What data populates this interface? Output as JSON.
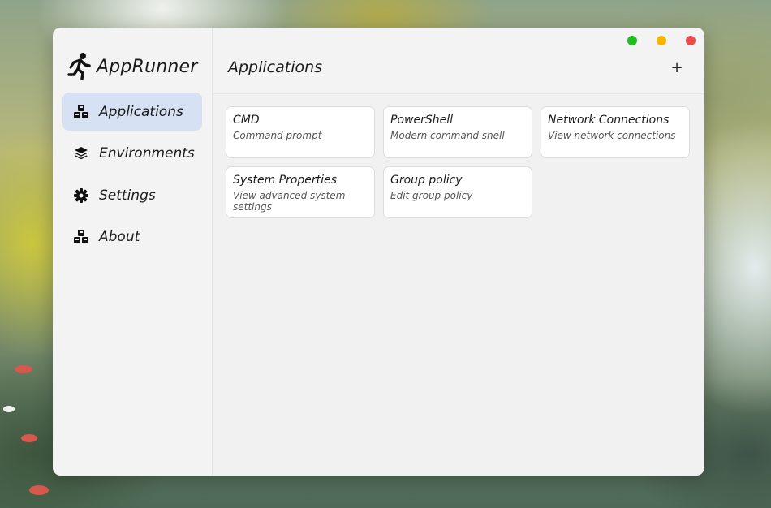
{
  "app": {
    "name": "AppRunner",
    "logo_icon": "running-person-icon"
  },
  "sidebar": {
    "items": [
      {
        "label": "Applications",
        "icon": "cubes-icon",
        "active": true
      },
      {
        "label": "Environments",
        "icon": "layers-icon",
        "active": false
      },
      {
        "label": "Settings",
        "icon": "gear-icon",
        "active": false
      },
      {
        "label": "About",
        "icon": "cubes-icon",
        "active": false
      }
    ]
  },
  "header": {
    "title": "Applications",
    "add_label": "+"
  },
  "window_controls": {
    "colors": {
      "green": "#1fbf1f",
      "yellow": "#f7b500",
      "red": "#ee4b4b"
    }
  },
  "apps": [
    {
      "title": "CMD",
      "desc": "Command prompt"
    },
    {
      "title": "PowerShell",
      "desc": "Modern command shell"
    },
    {
      "title": "Network Connections",
      "desc": "View network connections"
    },
    {
      "title": "System Properties",
      "desc": "View advanced system settings"
    },
    {
      "title": "Group policy",
      "desc": "Edit group policy"
    }
  ],
  "colors": {
    "active_nav": "#d6e2f3",
    "window_bg": "#f1f1f1",
    "card_bg": "#ffffff"
  }
}
